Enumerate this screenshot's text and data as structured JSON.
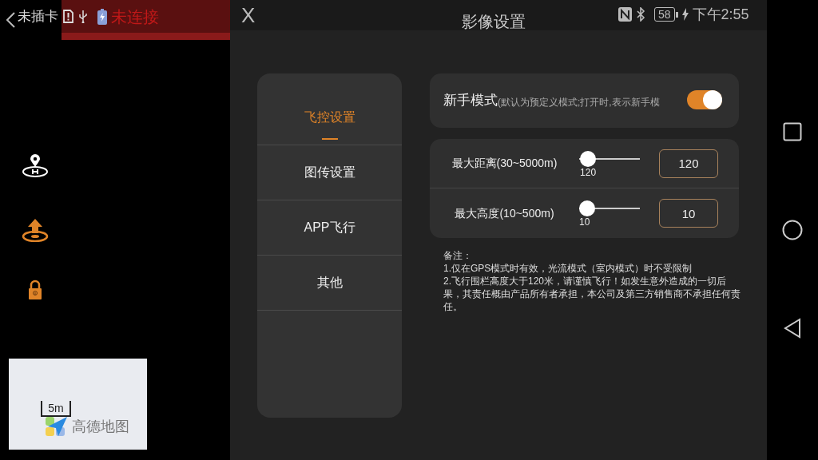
{
  "status_bar": {
    "sim": "未插卡",
    "connection": "未连接",
    "battery": "58",
    "time": "下午2:55"
  },
  "dialog": {
    "close": "X",
    "title": "影像设置"
  },
  "menu": [
    {
      "label": "飞控设置",
      "selected": true
    },
    {
      "label": "图传设置",
      "selected": false
    },
    {
      "label": "APP飞行",
      "selected": false
    },
    {
      "label": "其他",
      "selected": false
    }
  ],
  "toggle": {
    "label": "新手模式",
    "hint": "(默认为预定义模式;打开时,表示新手模",
    "on": true
  },
  "limits": [
    {
      "label": "最大距离(30~5000m)",
      "level": 0.02,
      "reading": "120",
      "value": "120"
    },
    {
      "label": "最大高度(10~500m)",
      "level": 0,
      "reading": "10",
      "value": "10"
    }
  ],
  "notes": [
    "备注：",
    "1.仅在GPS模式时有效，光流模式（室内模式）时不受限制",
    "2.飞行围栏高度大于120米，请谨慎飞行！如发生意外造成的一切后果，其责任概由产品所有者承担，本公司及第三方销售商不承担任何责任。"
  ],
  "map": {
    "scale": "5m",
    "brand": "高德地图"
  }
}
